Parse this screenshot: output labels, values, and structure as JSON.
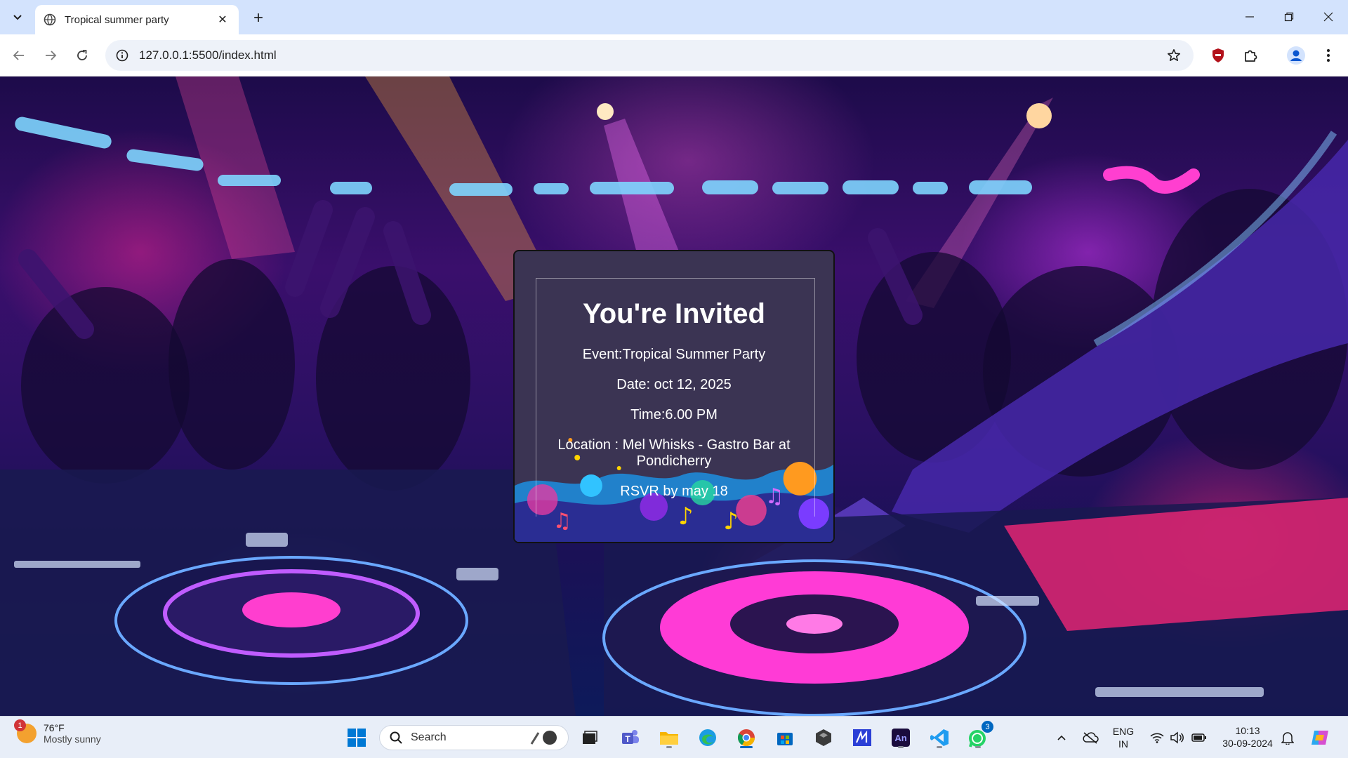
{
  "browser": {
    "tab_title": "Tropical summer party",
    "url": "127.0.0.1:5500/index.html",
    "new_tab_symbol": "+",
    "tab_close_symbol": "✕"
  },
  "invitation": {
    "heading": "You're Invited",
    "event": "Event:Tropical Summer Party",
    "date": "Date: oct 12, 2025",
    "time": "Time:6.00 PM",
    "location": "Location : Mel Whisks - Gastro Bar at Pondicherry",
    "rsvp": "RSVR by may 18"
  },
  "taskbar": {
    "weather_badge": "1",
    "weather_temp": "76°F",
    "weather_condition": "Mostly sunny",
    "search_label": "Search",
    "whatsapp_badge": "3",
    "language": "ENG",
    "region": "IN",
    "time": "10:13",
    "date": "30-09-2024",
    "pinned_apps": [
      "windows-start",
      "search",
      "task-view",
      "teams",
      "file-explorer",
      "edge",
      "chrome",
      "microsoft-store",
      "unity",
      "mathcad",
      "animate",
      "vscode",
      "whatsapp"
    ]
  },
  "colors": {
    "tab_strip": "#d3e3fd",
    "card_bg": "#3b3453",
    "taskbar_bg": "#e8eef8",
    "accent_blue": "#0067c0"
  }
}
